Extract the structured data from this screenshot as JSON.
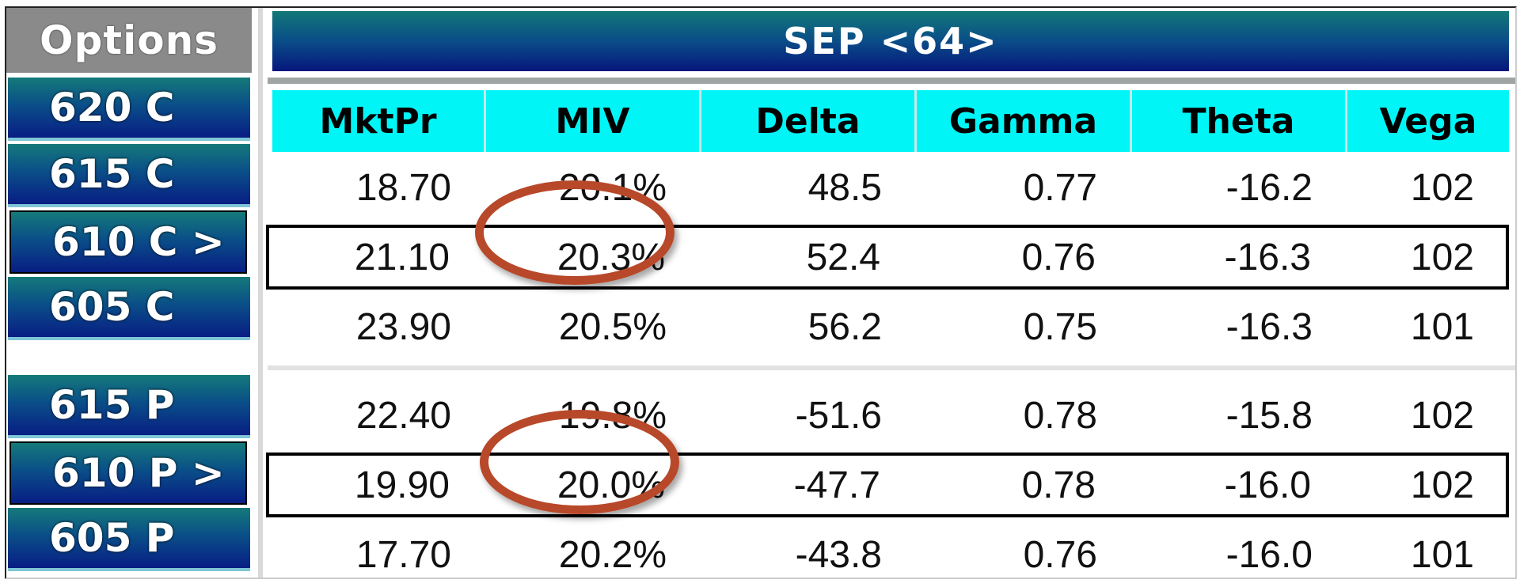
{
  "sidebar": {
    "header": "Options",
    "calls": [
      {
        "label": "620 C",
        "selected": false
      },
      {
        "label": "615 C",
        "selected": false
      },
      {
        "label": "610 C >",
        "selected": true
      },
      {
        "label": "605 C",
        "selected": false
      }
    ],
    "puts": [
      {
        "label": "615 P",
        "selected": false
      },
      {
        "label": "610 P >",
        "selected": true
      },
      {
        "label": "605 P",
        "selected": false
      }
    ]
  },
  "panel": {
    "title": "SEP <64>",
    "columns": [
      "MktPr",
      "MIV",
      "Delta",
      "Gamma",
      "Theta",
      "Vega"
    ],
    "call_rows": [
      {
        "strike": "615 C",
        "values": [
          "18.70",
          "20.1%",
          "48.5",
          "0.77",
          "-16.2",
          "102"
        ],
        "selected": false
      },
      {
        "strike": "610 C",
        "values": [
          "21.10",
          "20.3%",
          "52.4",
          "0.76",
          "-16.3",
          "102"
        ],
        "selected": true
      },
      {
        "strike": "605 C",
        "values": [
          "23.90",
          "20.5%",
          "56.2",
          "0.75",
          "-16.3",
          "101"
        ],
        "selected": false
      }
    ],
    "put_rows": [
      {
        "strike": "615 P",
        "values": [
          "22.40",
          "19.8%",
          "-51.6",
          "0.78",
          "-15.8",
          "102"
        ],
        "selected": false
      },
      {
        "strike": "610 P",
        "values": [
          "19.90",
          "20.0%",
          "-47.7",
          "0.78",
          "-16.0",
          "102"
        ],
        "selected": true
      },
      {
        "strike": "605 P",
        "values": [
          "17.70",
          "20.2%",
          "-43.8",
          "0.76",
          "-16.0",
          "101"
        ],
        "selected": false
      }
    ]
  },
  "annotations": {
    "highlight_color": "#b8482a",
    "circled_values": [
      "20.3%",
      "20.0%"
    ]
  },
  "colors": {
    "header_cyan": "#00f6f6",
    "button_dark": "#081e84",
    "button_teal": "#157a7a"
  }
}
